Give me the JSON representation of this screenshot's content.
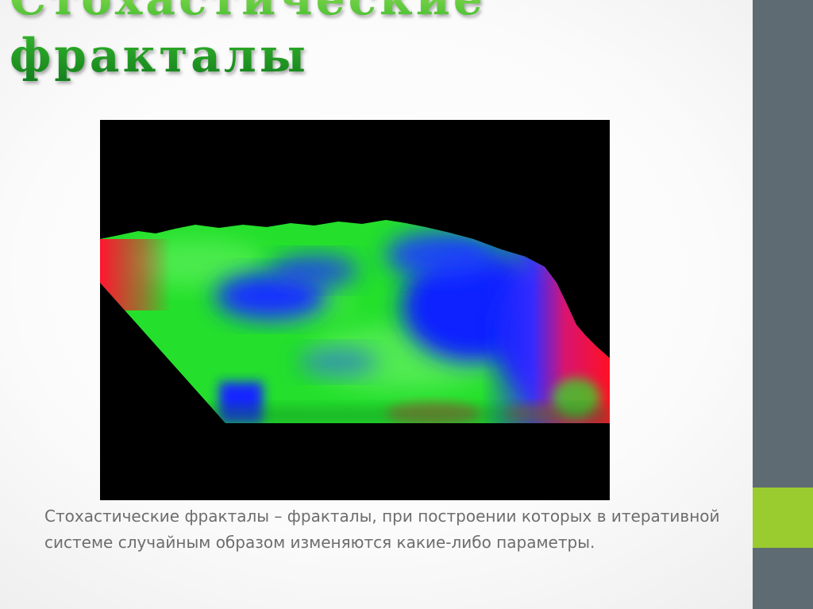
{
  "slide": {
    "title": "Стохастические фракталы",
    "caption": "Стохастические фракталы – фракталы, при построении которых в итеративной системе случайным образом изменяются какие-либо параметры."
  },
  "figure": {
    "description_colors": {
      "background": "#000000",
      "low": "#0a2cff",
      "mid": "#22ee22",
      "high": "#ff1530"
    }
  },
  "theme": {
    "sidebar_color": "#5e6b72",
    "accent_color": "#9acb2f",
    "title_color": "#32b42a",
    "caption_color": "#6d6d6d"
  }
}
